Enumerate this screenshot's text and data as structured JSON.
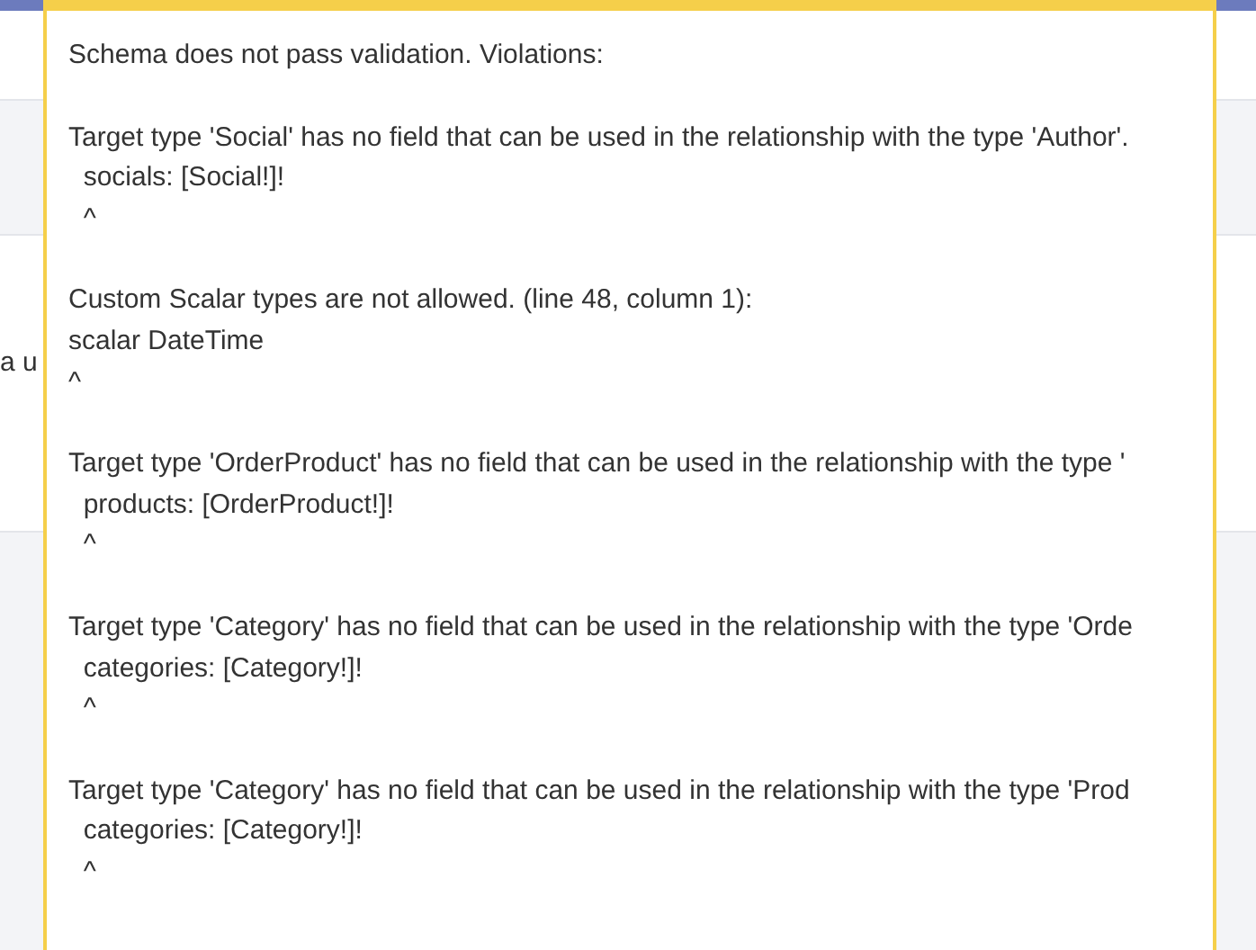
{
  "page_behind": {
    "partial_text": "a u"
  },
  "error_popover": {
    "heading": "Schema does not pass validation. Violations:",
    "violations": [
      {
        "message": "Target type 'Social' has no field that can be used in the relationship with the type 'Author'.",
        "lines": [
          "  socials: [Social!]!",
          "  ^"
        ]
      },
      {
        "message": "Custom Scalar types are not allowed. (line 48, column 1):",
        "lines": [
          "scalar DateTime",
          "^"
        ]
      },
      {
        "message": "Target type 'OrderProduct' has no field that can be used in the relationship with the type '",
        "lines": [
          "  products: [OrderProduct!]!",
          "  ^"
        ]
      },
      {
        "message": "Target type 'Category' has no field that can be used in the relationship with the type 'Orde",
        "lines": [
          "  categories: [Category!]!",
          "  ^"
        ]
      },
      {
        "message": "Target type 'Category' has no field that can be used in the relationship with the type 'Prod",
        "lines": [
          "  categories: [Category!]!",
          "  ^"
        ]
      }
    ]
  }
}
